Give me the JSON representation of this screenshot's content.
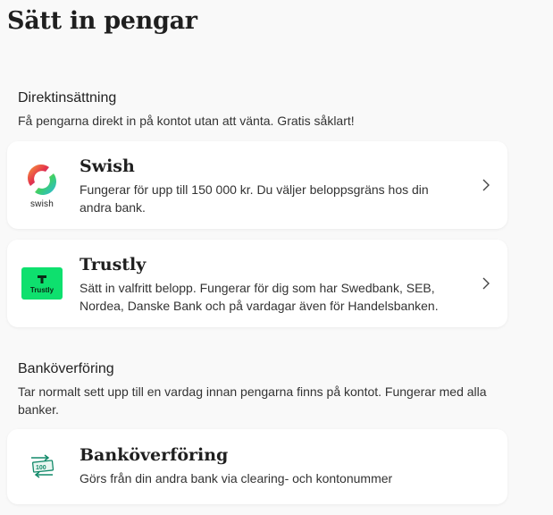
{
  "page": {
    "title": "Sätt in pengar"
  },
  "direct": {
    "heading": "Direktinsättning",
    "description": "Få pengarna direkt in på kontot utan att vänta. Gratis såklart!"
  },
  "options": [
    {
      "name": "Swish",
      "description": "Fungerar för upp till 150 000 kr. Du väljer beloppsgräns hos din andra bank.",
      "logo_text": "swish",
      "icon": "swish-logo"
    },
    {
      "name": "Trustly",
      "description": "Sätt in valfritt belopp. Fungerar för dig som har Swedbank, SEB, Nordea, Danske Bank och på vardagar även för Handelsbanken.",
      "logo_text": "Trustly",
      "icon": "trustly-logo",
      "brand_color": "#0ee06e"
    }
  ],
  "bank": {
    "heading": "Banköverföring",
    "description": "Tar normalt sett upp till en vardag innan pengarna finns på kontot. Fungerar med alla banker.",
    "option": {
      "name": "Banköverföring",
      "description": "Görs från din andra bank via clearing- och kontonummer",
      "icon": "bank-transfer-icon",
      "icon_text": "100",
      "accent": "#138a6a"
    }
  }
}
